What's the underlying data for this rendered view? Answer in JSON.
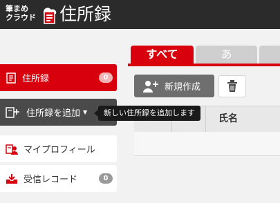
{
  "header": {
    "brand_line1": "筆まめ",
    "brand_line2": "クラウド",
    "title": "住所録"
  },
  "sidebar": {
    "items": [
      {
        "label": "住所録",
        "count": "0",
        "icon": "address-book-icon",
        "active": true
      },
      {
        "label": "住所録を追加",
        "icon": "add-address-book-icon",
        "caret": "▼"
      },
      {
        "label": "マイプロフィール",
        "icon": "profile-icon"
      },
      {
        "label": "受信レコード",
        "count": "0",
        "icon": "inbox-icon"
      }
    ]
  },
  "tooltip": {
    "text": "新しい住所録を追加します"
  },
  "tabs": [
    {
      "label": "すべて",
      "active": true
    },
    {
      "label": "あ"
    },
    {
      "label": ""
    }
  ],
  "toolbar": {
    "new_label": "新規作成",
    "trash_icon": "trash-icon"
  },
  "table": {
    "columns": [
      "",
      "",
      "氏名"
    ]
  },
  "colors": {
    "accent": "#d9000d",
    "header_bg": "#2b2b2b",
    "dark_button": "#4a4a4a"
  }
}
